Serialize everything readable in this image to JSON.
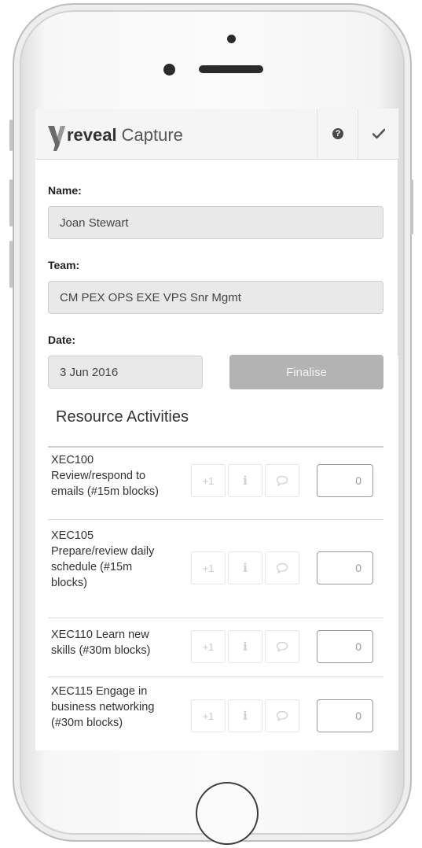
{
  "header": {
    "brand": "reveal",
    "app_name": "Capture",
    "help_icon": "question-circle-icon",
    "done_icon": "checkmark-icon"
  },
  "form": {
    "name_label": "Name:",
    "name_value": "Joan Stewart",
    "team_label": "Team:",
    "team_value": "CM PEX OPS EXE VPS Snr Mgmt",
    "date_label": "Date:",
    "date_value": "3 Jun 2016",
    "finalise_label": "Finalise"
  },
  "section_title": "Resource Activities",
  "activity_buttons": {
    "plus_one_label": "+1",
    "info_icon": "info-icon",
    "comment_icon": "speech-bubble-icon"
  },
  "activities": [
    {
      "line1": "XEC100",
      "line2": "Review/respond to",
      "line3": "emails (#15m blocks)",
      "line4": "",
      "count": "0"
    },
    {
      "line1": "XEC105",
      "line2": "Prepare/review daily",
      "line3": "schedule (#15m",
      "line4": "blocks)",
      "count": "0"
    },
    {
      "line1": "XEC110 Learn new",
      "line2": "skills (#30m blocks)",
      "line3": "",
      "line4": "",
      "count": "0"
    },
    {
      "line1": "XEC115 Engage in",
      "line2": "business networking",
      "line3": "(#30m blocks)",
      "line4": "",
      "count": "0"
    }
  ],
  "colors": {
    "header_bg": "#f5f5f5",
    "field_bg": "#e9e9e9",
    "finalise_disabled": "#b3b3b3",
    "text": "#333333"
  }
}
